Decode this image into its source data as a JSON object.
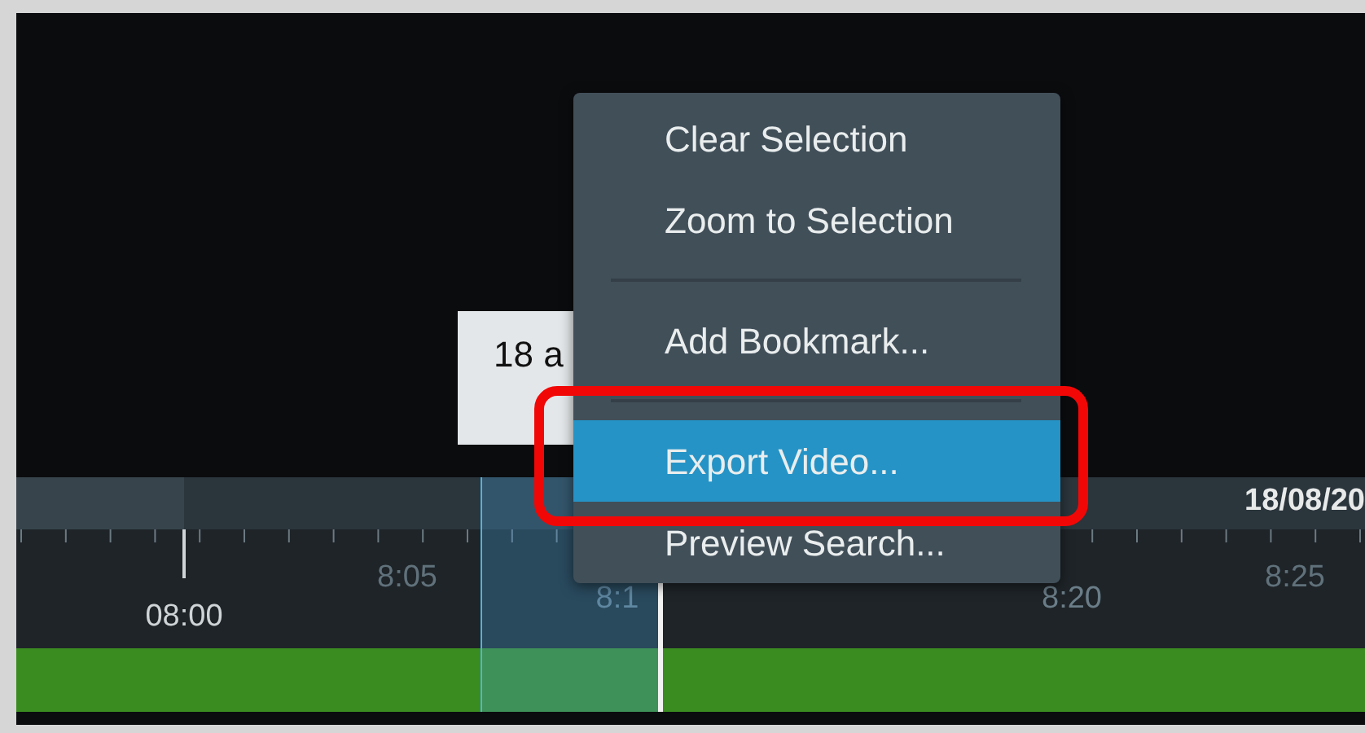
{
  "tooltip": {
    "text": "18 a"
  },
  "context_menu": {
    "items": [
      {
        "kind": "item",
        "label": "Clear Selection",
        "selected": false
      },
      {
        "kind": "item",
        "label": "Zoom to Selection",
        "selected": false
      },
      {
        "kind": "divider"
      },
      {
        "kind": "item",
        "label": "Add Bookmark...",
        "selected": false
      },
      {
        "kind": "divider"
      },
      {
        "kind": "item",
        "label": "Export Video...",
        "selected": true
      },
      {
        "kind": "item",
        "label": "Preview Search...",
        "selected": false
      }
    ]
  },
  "timeline": {
    "date": "18/08/20",
    "labels": [
      {
        "text": "08:00",
        "kind": "major"
      },
      {
        "text": "8:05",
        "kind": "minor"
      },
      {
        "text": "8:1",
        "kind": "minor"
      },
      {
        "text": "8:20",
        "kind": "minor"
      },
      {
        "text": "8:25",
        "kind": "minor"
      }
    ]
  }
}
